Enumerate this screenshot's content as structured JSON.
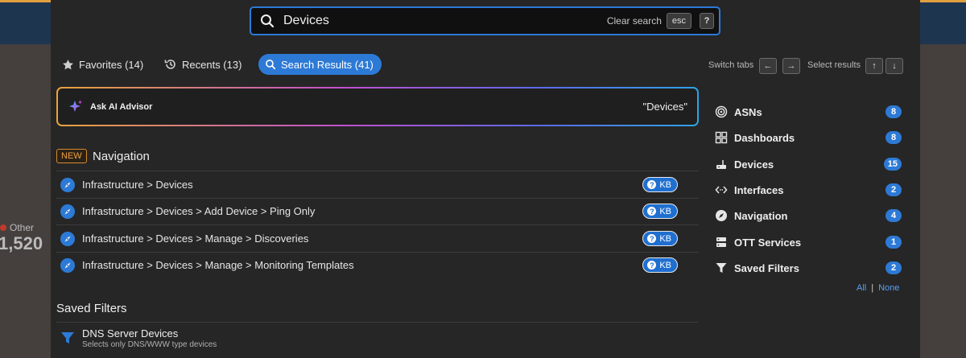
{
  "background": {
    "legend_label": "Other",
    "big_number": "1,520"
  },
  "search": {
    "value": "Devices",
    "clear_label": "Clear search",
    "esc_key": "esc",
    "help_key": "?"
  },
  "tabs": {
    "favorites": "Favorites (14)",
    "recents": "Recents (13)",
    "search_results": "Search Results (41)"
  },
  "shortcuts": {
    "switch_tabs": "Switch tabs",
    "select_results": "Select results",
    "left": "←",
    "right": "→",
    "up": "↑",
    "down": "↓"
  },
  "ai": {
    "label": "Ask AI Advisor",
    "query": "\"Devices\""
  },
  "navigation": {
    "badge": "NEW",
    "heading": "Navigation",
    "kb_label": "KB",
    "kb_icon": "?",
    "items": [
      {
        "label": "Infrastructure > Devices"
      },
      {
        "label": "Infrastructure > Devices > Add Device > Ping Only"
      },
      {
        "label": "Infrastructure > Devices > Manage > Discoveries"
      },
      {
        "label": "Infrastructure > Devices > Manage > Monitoring Templates"
      }
    ]
  },
  "saved_filters": {
    "heading": "Saved Filters",
    "items": [
      {
        "name": "DNS Server Devices",
        "description": "Selects only DNS/WWW type devices"
      }
    ]
  },
  "categories": [
    {
      "label": "ASNs",
      "count": "8",
      "icon": "target-icon"
    },
    {
      "label": "Dashboards",
      "count": "8",
      "icon": "grid-icon"
    },
    {
      "label": "Devices",
      "count": "15",
      "icon": "router-icon"
    },
    {
      "label": "Interfaces",
      "count": "2",
      "icon": "arrows-icon"
    },
    {
      "label": "Navigation",
      "count": "4",
      "icon": "compass-icon"
    },
    {
      "label": "OTT Services",
      "count": "1",
      "icon": "server-icon"
    },
    {
      "label": "Saved Filters",
      "count": "2",
      "icon": "funnel-icon"
    }
  ],
  "selection": {
    "all": "All",
    "separator": "|",
    "none": "None"
  },
  "colors": {
    "accent": "#2d7ad6",
    "new_badge": "#f0a040",
    "kb_badge": "#1f6fd0"
  }
}
